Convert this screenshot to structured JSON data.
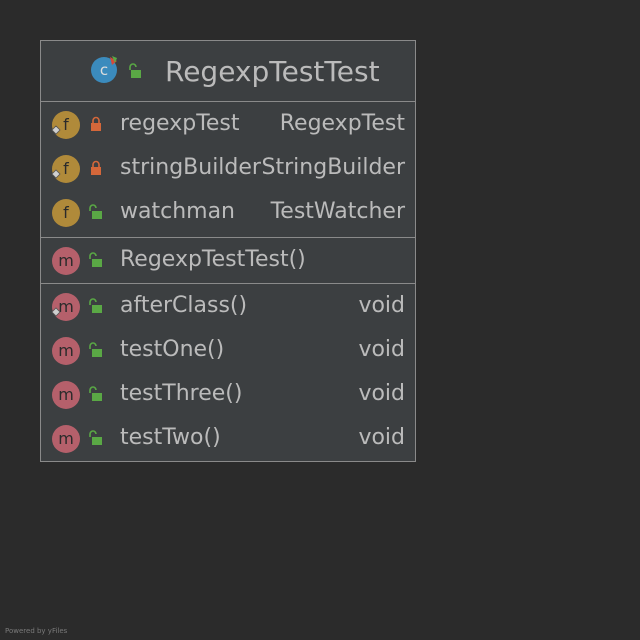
{
  "diagram": {
    "class": {
      "name": "RegexpTestTest",
      "kind": "class",
      "kind_letter": "c",
      "visibility": "public"
    },
    "fields": [
      {
        "name": "regexpTest",
        "type": "RegexpTest",
        "kind_letter": "f",
        "visibility": "private",
        "has_rule_marker": true
      },
      {
        "name": "stringBuilder",
        "type": "StringBuilder",
        "kind_letter": "f",
        "visibility": "private",
        "has_rule_marker": true
      },
      {
        "name": "watchman",
        "type": "TestWatcher",
        "kind_letter": "f",
        "visibility": "public",
        "has_rule_marker": false
      }
    ],
    "constructors": [
      {
        "name": "RegexpTestTest()",
        "type": "",
        "kind_letter": "m",
        "visibility": "public",
        "has_rule_marker": false
      }
    ],
    "methods": [
      {
        "name": "afterClass()",
        "type": "void",
        "kind_letter": "m",
        "visibility": "public",
        "has_rule_marker": true
      },
      {
        "name": "testOne()",
        "type": "void",
        "kind_letter": "m",
        "visibility": "public",
        "has_rule_marker": false
      },
      {
        "name": "testThree()",
        "type": "void",
        "kind_letter": "m",
        "visibility": "public",
        "has_rule_marker": false
      },
      {
        "name": "testTwo()",
        "type": "void",
        "kind_letter": "m",
        "visibility": "public",
        "has_rule_marker": false
      }
    ]
  },
  "footer": {
    "powered_by": "Powered by yFiles"
  },
  "colors": {
    "background": "#2b2b2b",
    "box_fill": "#3c3f41",
    "box_border": "#8a8a8a",
    "text": "#bbbbbb",
    "field_icon": "#b08a3a",
    "method_icon": "#b5606b",
    "class_icon": "#3b8bbd",
    "lock_private": "#d4673a",
    "lock_public": "#5aa845"
  }
}
